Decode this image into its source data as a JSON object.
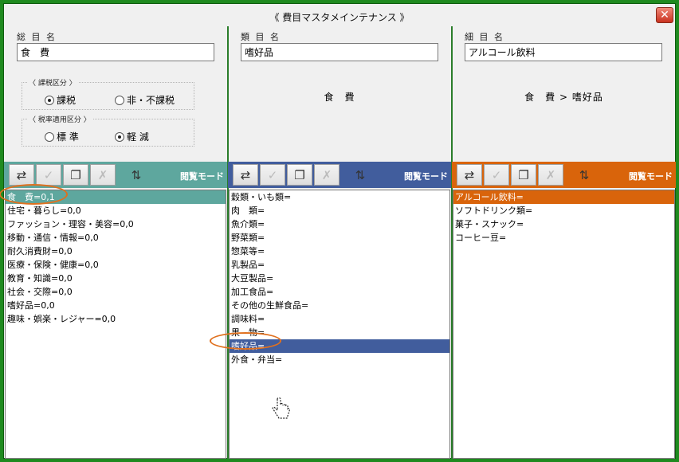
{
  "window": {
    "title": "《 費目マスタメインテナンス 》",
    "close_glyph": "✕"
  },
  "columns": [
    {
      "label": "総 目 名",
      "value": "食　費",
      "accent": "#5ea79e",
      "mode": "閲覧モード",
      "items": [
        "食　費=0,1",
        "住宅・暮らし=0,0",
        "ファッション・理容・美容=0,0",
        "移動・通信・情報=0,0",
        "耐久消費財=0,0",
        "医療・保険・健康=0,0",
        "教育・知識=0,0",
        "社会・交際=0,0",
        "嗜好品=0,0",
        "趣味・娯楽・レジャー=0,0"
      ],
      "selected_index": 0
    },
    {
      "label": "類 目 名",
      "value": "嗜好品",
      "caption": "食　費",
      "accent": "#415d9d",
      "mode": "閲覧モード",
      "items": [
        "穀類・いも類=",
        "肉　類=",
        "魚介類=",
        "野菜類=",
        "惣菜等=",
        "乳製品=",
        "大豆製品=",
        "加工食品=",
        "その他の生鮮食品=",
        "調味料=",
        "果　物=",
        "嗜好品=",
        "外食・弁当="
      ],
      "selected_index": 11
    },
    {
      "label": "細 目 名",
      "value": "アルコール飲料",
      "caption": "食　費 > 嗜好品",
      "accent": "#d9640b",
      "mode": "閲覧モード",
      "items": [
        "アルコール飲料=",
        "ソフトドリンク類=",
        "菓子・スナック=",
        "コーヒー豆="
      ],
      "selected_index": 0
    }
  ],
  "tax_group": {
    "legend": "〈 課税区分 〉",
    "options": [
      "課税",
      "非・不課税"
    ],
    "selected": 0
  },
  "rate_group": {
    "legend": "〈 税率適用区分 〉",
    "options": [
      "標 準",
      "軽 減"
    ],
    "selected": 1
  },
  "toolbar_icons": [
    "transfer-icon",
    "check-icon",
    "copy-icon",
    "delete-icon",
    "sort-icon"
  ],
  "annotation_color": "#e0701e"
}
